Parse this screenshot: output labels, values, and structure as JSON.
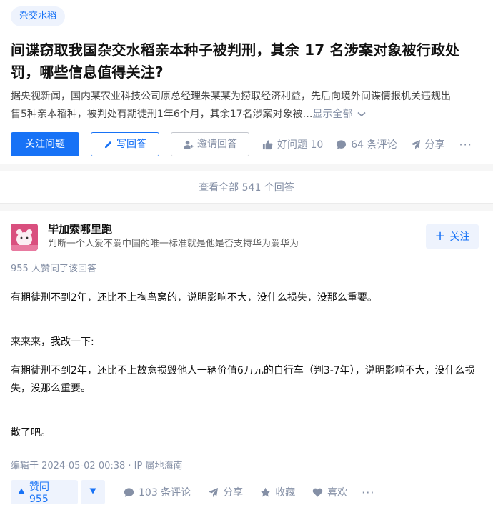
{
  "question": {
    "topic": "杂交水稻",
    "title": "间谍窃取我国杂交水稻亲本种子被判刑，其余 17 名涉案对象被行政处罚，哪些信息值得关注?",
    "excerpt_line1": "据央视新闻，国内某农业科技公司原总经理朱某某为捞取经济利益，先后向境外间谍情报机关违规出",
    "excerpt_line2": "售5种亲本稻种，被判处有期徒刑1年6个月，其余17名涉案对象被…",
    "show_all": "显示全部",
    "actions": {
      "follow": "关注问题",
      "write": "写回答",
      "invite": "邀请回答",
      "good_question": "好问题 10",
      "comments": "64 条评论",
      "share": "分享",
      "more": "···"
    }
  },
  "view_all": "查看全部 541 个回答",
  "answer": {
    "author_name": "毕加索哪里跑",
    "author_bio": "判断一个人爱不爱中国的唯一标准就是他是否支持华为爱华为",
    "follow": "关注",
    "upvote_info": "955 人赞同了该回答",
    "paragraphs": [
      "有期徒刑不到2年，还比不上掏鸟窝的，说明影响不大，没什么损失，没那么重要。",
      "来来来，我改一下:",
      "有期徒刑不到2年，还比不上故意损毁他人一辆价值6万元的自行车（判3-7年），说明影响不大，没什么损失，没那么重要。",
      "散了吧。"
    ],
    "edit_info": "编辑于 2024-05-02 00:38 · IP 属地海南",
    "actions": {
      "upvote": "赞同 955",
      "comments": "103 条评论",
      "share": "分享",
      "collect": "收藏",
      "like": "喜欢",
      "more": "···"
    }
  },
  "colors": {
    "accent": "#1772f6",
    "accent_bg": "#eef3fd",
    "muted": "#8590a6"
  }
}
